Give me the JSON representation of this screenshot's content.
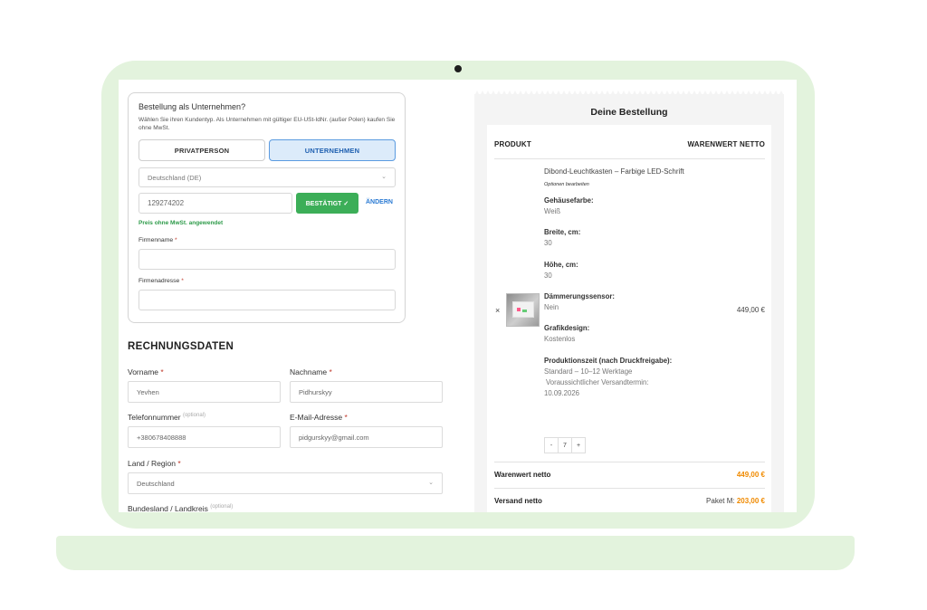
{
  "company": {
    "title": "Bestellung als Unternehmen?",
    "description": "Wählen Sie ihren Kundentyp. Als Unternehmen mit gültiger EU-USt-IdNr. (außer Polen) kaufen Sie ohne MwSt.",
    "segment_private": "PRIVATPERSON",
    "segment_company": "UNTERNEHMEN",
    "country_value": "Deutschland (DE)",
    "vat_value": "129274202",
    "confirmed_label": "BESTÄTIGT ✓",
    "change_label": "ÄNDERN",
    "vat_applied_text": "Preis ohne MwSt. angewendet",
    "firm_name_label": "Firmenname",
    "firm_address_label": "Firmenadresse",
    "required_mark": "*"
  },
  "billing": {
    "title": "RECHNUNGSDATEN",
    "first_name_label": "Vorname",
    "first_name_value": "Yevhen",
    "last_name_label": "Nachname",
    "last_name_value": "Pidhurskyy",
    "phone_label": "Telefonnummer",
    "optional_tag": "(optional)",
    "phone_value": "+380678408888",
    "email_label": "E-Mail-Adresse",
    "email_value": "pidgurskyy@gmail.com",
    "country_label": "Land / Region",
    "country_value": "Deutschland",
    "state_label": "Bundesland / Landkreis",
    "required_mark": "*"
  },
  "order": {
    "title": "Deine Bestellung",
    "col_product": "PRODUKT",
    "col_value": "WARENWERT NETTO",
    "product_name": "Dibond-Leuchtkasten – Farbige LED-Schrift",
    "edit_options": "Optionen bearbeiten",
    "options": [
      {
        "key": "Gehäusefarbe:",
        "value": "Weiß"
      },
      {
        "key": "Breite, cm:",
        "value": "30"
      },
      {
        "key": "Höhe, cm:",
        "value": "30"
      },
      {
        "key": "Dämmerungssensor:",
        "value": "Nein"
      },
      {
        "key": "Grafikdesign:",
        "value": "Kostenlos"
      },
      {
        "key": "Produktionszeit (nach Druckfreigabe):",
        "value": "Standard – 10–12 Werktage"
      }
    ],
    "shipping_note_1": "Voraussichtlicher Versandtermin:",
    "shipping_note_2": "10.09.2026",
    "remove": "×",
    "line_price": "449,00 €",
    "qty_minus": "-",
    "qty_value": "7",
    "qty_plus": "+",
    "subtotal_label": "Warenwert netto",
    "subtotal_value": "449,00 €",
    "shipping_label": "Versand netto",
    "shipping_prefix": "Paket M:",
    "shipping_value": "203,00 €"
  },
  "colors": {
    "laptop": "#e3f3dd",
    "accent_green": "#3cae58",
    "accent_blue": "#2a7ad3",
    "price_orange": "#f08a00"
  }
}
